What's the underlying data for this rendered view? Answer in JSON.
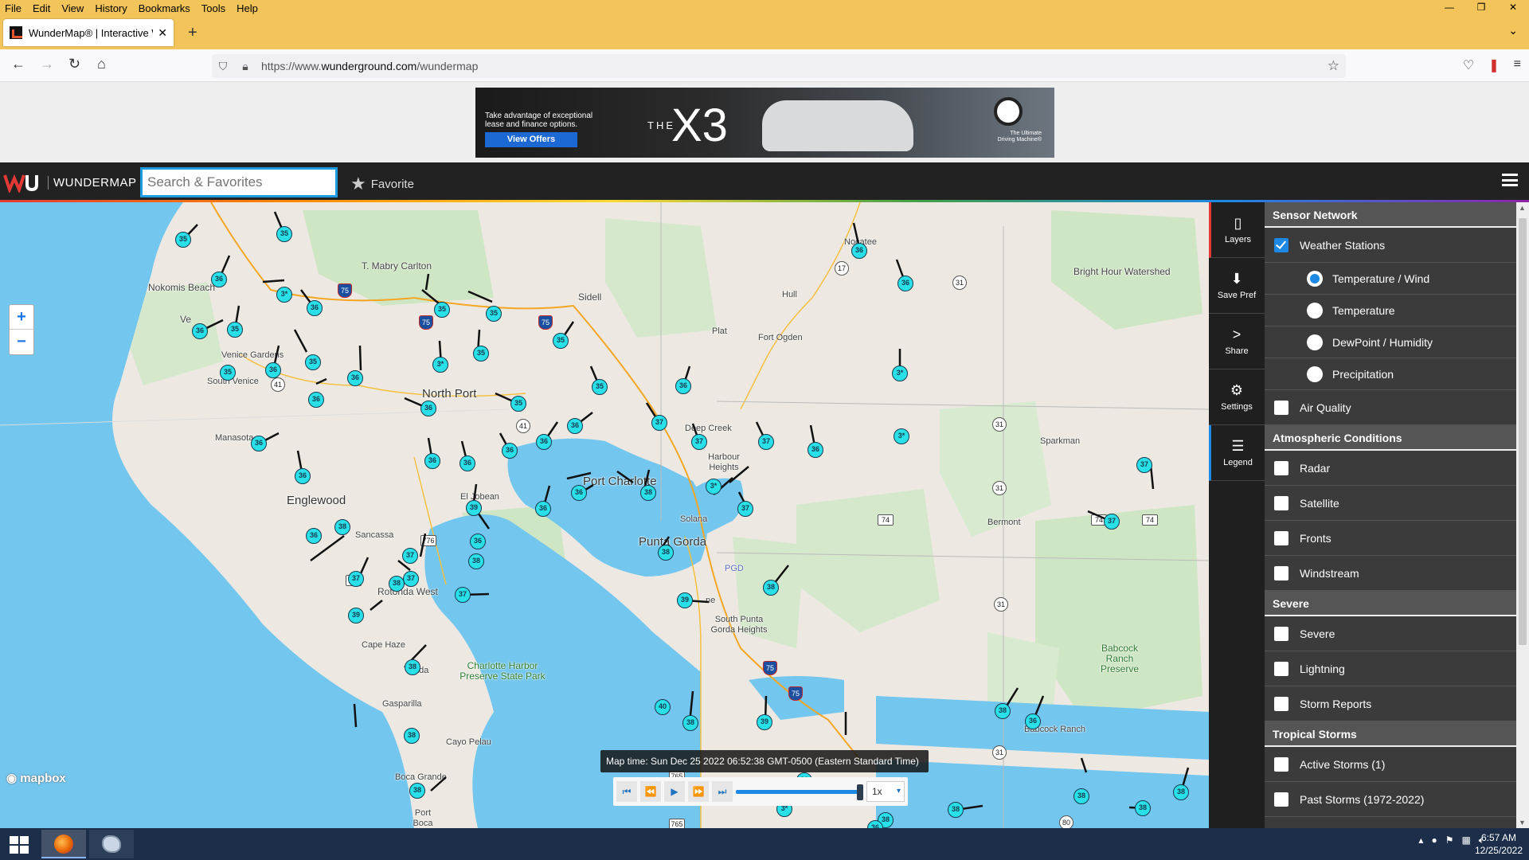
{
  "browser": {
    "menu": [
      "File",
      "Edit",
      "View",
      "History",
      "Bookmarks",
      "Tools",
      "Help"
    ],
    "tab_title": "WunderMap® | Interactive We",
    "url_prefix": "https://www.",
    "url_domain": "wunderground.com",
    "url_path": "/wundermap"
  },
  "ad": {
    "text": "Take advantage of exceptional lease and finance options.",
    "button": "View Offers",
    "the": "THE",
    "model": "X3",
    "tagline_1": "The Ultimate",
    "tagline_2": "Driving Machine®"
  },
  "header": {
    "title": "WUNDERMAP",
    "search_placeholder": "Search & Favorites",
    "favorite": "Favorite"
  },
  "map": {
    "zoom_in": "+",
    "zoom_out": "−",
    "attribution": "mapbox",
    "map_time": "Map time: Sun Dec 25 2022 06:52:38 GMT-0500 (Eastern Standard Time)",
    "speed": "1x",
    "places": [
      "T. Mabry Carlton",
      "Nokomis Beach",
      "Ve",
      "Venice Gardens",
      "South Venice",
      "Manasota",
      "Englewood",
      "Sidell",
      "North Port",
      "El Jobean",
      "Port Charlotte",
      "Sancassa",
      "Rotonda West",
      "Cape Haze",
      "ada",
      "Gasparilla",
      "Cayo Pelau",
      "Boca Grande",
      "Port Boca Grande",
      "Charlotte Harbor Preserve State Park",
      "Punta Gorda",
      "Solana",
      "Harbour Heights",
      "Deep Creek",
      "Plat",
      "Fort Ogden",
      "Hull",
      "Nocatee",
      "Bright Hour Watershed",
      "Sparkman",
      "Bermont",
      "South Punta Gorda Heights",
      "Babcock Ranch Preserve",
      "Babcock Ranch",
      "PGD",
      "ne"
    ],
    "stations": [
      "35",
      "36",
      "35",
      "3*",
      "36",
      "35",
      "36",
      "35",
      "35",
      "36",
      "35",
      "36",
      "3*",
      "36",
      "36",
      "35",
      "3*",
      "35",
      "35",
      "35",
      "35",
      "36",
      "36",
      "36",
      "36",
      "36",
      "36",
      "36",
      "36",
      "36",
      "37",
      "36",
      "39",
      "37",
      "36",
      "37",
      "38",
      "36",
      "37",
      "36",
      "37",
      "3*",
      "37",
      "37",
      "36",
      "37",
      "38",
      "38",
      "38",
      "37",
      "37",
      "38",
      "38",
      "39",
      "39",
      "38",
      "40",
      "38",
      "39",
      "38",
      "38",
      "36",
      "36",
      "38",
      "38",
      "3*",
      "38",
      "38",
      "38",
      "38",
      "36",
      "36",
      "3*"
    ],
    "shields": [
      "75",
      "75",
      "75",
      "41",
      "41",
      "776",
      "775",
      "17",
      "31",
      "31",
      "31",
      "31",
      "31",
      "74",
      "74",
      "74",
      "765",
      "765",
      "80",
      "75",
      "75"
    ]
  },
  "iconbar": [
    {
      "label": "Layers",
      "icon": "layers-icon"
    },
    {
      "label": "Save Pref",
      "icon": "save-icon"
    },
    {
      "label": "Share",
      "icon": "share-icon"
    },
    {
      "label": "Settings",
      "icon": "gear-icon"
    },
    {
      "label": "Legend",
      "icon": "list-icon"
    }
  ],
  "panel": {
    "sensor_network": "Sensor Network",
    "weather_stations": "Weather Stations",
    "temp_wind": "Temperature / Wind",
    "temperature": "Temperature",
    "dewpoint": "DewPoint / Humidity",
    "precipitation": "Precipitation",
    "air_quality": "Air Quality",
    "atmospheric": "Atmospheric Conditions",
    "radar": "Radar",
    "satellite": "Satellite",
    "fronts": "Fronts",
    "windstream": "Windstream",
    "severe_head": "Severe",
    "severe": "Severe",
    "lightning": "Lightning",
    "storm_reports": "Storm Reports",
    "tropical": "Tropical Storms",
    "active_storms": "Active Storms (1)",
    "past_storms": "Past Storms (1972-2022)"
  },
  "taskbar": {
    "time": "6:57 AM",
    "date": "12/25/2022"
  },
  "colors": {
    "browser_chrome": "#f3c45a",
    "header_bg": "#222222",
    "station_fill": "#29e0e8",
    "water": "#73c6ee",
    "panel_bg": "#3b3b3b",
    "accent_blue": "#1e88e5"
  }
}
